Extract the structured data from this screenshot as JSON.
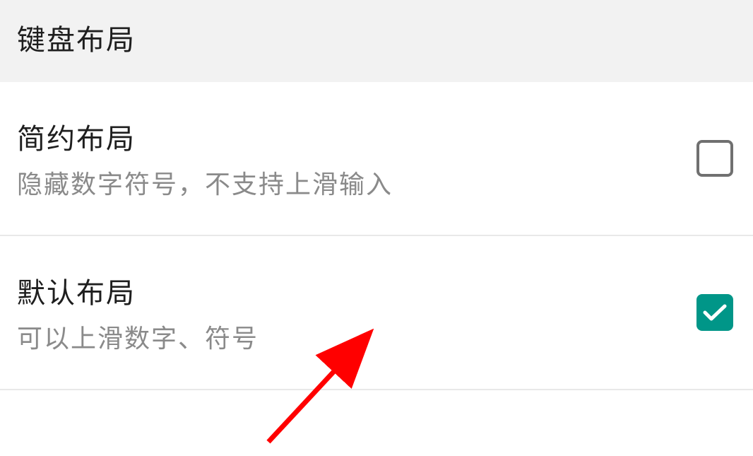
{
  "header": {
    "title": "键盘布局"
  },
  "settings": {
    "items": [
      {
        "title": "简约布局",
        "description": "隐藏数字符号，不支持上滑输入",
        "checked": false
      },
      {
        "title": "默认布局",
        "description": "可以上滑数字、符号",
        "checked": true
      }
    ]
  },
  "colors": {
    "accent": "#009688"
  }
}
